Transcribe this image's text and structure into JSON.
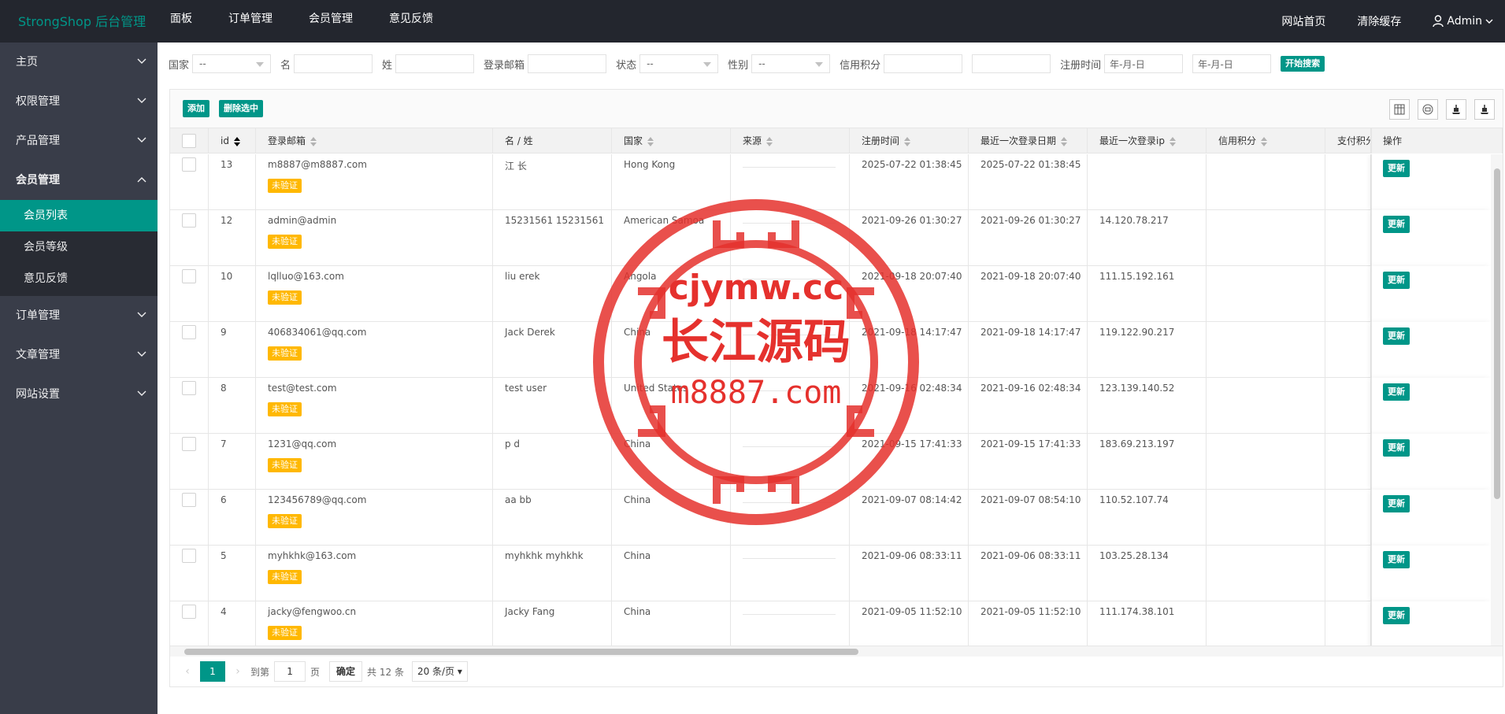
{
  "app": {
    "logo": "StrongShop 后台管理",
    "top_nav": [
      "面板",
      "订单管理",
      "会员管理",
      "意见反馈"
    ],
    "top_right": {
      "home": "网站首页",
      "clear_cache": "清除缓存",
      "user": "Admin"
    }
  },
  "sidebar": {
    "items": [
      {
        "label": "主页"
      },
      {
        "label": "权限管理"
      },
      {
        "label": "产品管理"
      },
      {
        "label": "会员管理"
      },
      {
        "label": "订单管理"
      },
      {
        "label": "文章管理"
      },
      {
        "label": "网站设置"
      }
    ],
    "submenu": [
      "会员列表",
      "会员等级",
      "意见反馈"
    ]
  },
  "filters": {
    "country_label": "国家",
    "country_value": "--",
    "first_name_label": "名",
    "last_name_label": "姓",
    "email_label": "登录邮箱",
    "status_label": "状态",
    "status_value": "--",
    "gender_label": "性别",
    "gender_value": "--",
    "credit_label": "信用积分",
    "reg_time_label": "注册时间",
    "date_placeholder_from": "年-月-日",
    "date_placeholder_to": "年-月-日",
    "search_button": "开始搜索"
  },
  "toolbar": {
    "add": "添加",
    "delete_selected": "删除选中"
  },
  "table": {
    "headers": {
      "id": "id",
      "email": "登录邮箱",
      "name": "名 / 姓",
      "country": "国家",
      "source": "来源",
      "reg_time": "注册时间",
      "last_login_date": "最近一次登录日期",
      "last_login_ip": "最近一次登录ip",
      "credit": "信用积分",
      "pay": "支付积分",
      "op": "操作"
    },
    "unverified_label": "未验证",
    "update_label": "更新",
    "rows": [
      {
        "id": "13",
        "email": "m8887@m8887.com",
        "name": "江 长",
        "country": "Hong Kong",
        "reg": "2025-07-22 01:38:45",
        "last": "2025-07-22 01:38:45",
        "ip": ""
      },
      {
        "id": "12",
        "email": "admin@admin",
        "name": "15231561 15231561",
        "country": "American Samoa",
        "reg": "2021-09-26 01:30:27",
        "last": "2021-09-26 01:30:27",
        "ip": "14.120.78.217"
      },
      {
        "id": "10",
        "email": "lqlluo@163.com",
        "name": "liu erek",
        "country": "Angola",
        "reg": "2021-09-18 20:07:40",
        "last": "2021-09-18 20:07:40",
        "ip": "111.15.192.161"
      },
      {
        "id": "9",
        "email": "406834061@qq.com",
        "name": "Jack Derek",
        "country": "China",
        "reg": "2021-09-18 14:17:47",
        "last": "2021-09-18 14:17:47",
        "ip": "119.122.90.217"
      },
      {
        "id": "8",
        "email": "test@test.com",
        "name": "test user",
        "country": "United States",
        "reg": "2021-09-16 02:48:34",
        "last": "2021-09-16 02:48:34",
        "ip": "123.139.140.52"
      },
      {
        "id": "7",
        "email": "1231@qq.com",
        "name": "p d",
        "country": "China",
        "reg": "2021-09-15 17:41:33",
        "last": "2021-09-15 17:41:33",
        "ip": "183.69.213.197"
      },
      {
        "id": "6",
        "email": "123456789@qq.com",
        "name": "aa bb",
        "country": "China",
        "reg": "2021-09-07 08:14:42",
        "last": "2021-09-07 08:54:10",
        "ip": "110.52.107.74"
      },
      {
        "id": "5",
        "email": "myhkhk@163.com",
        "name": "myhkhk myhkhk",
        "country": "China",
        "reg": "2021-09-06 08:33:11",
        "last": "2021-09-06 08:33:11",
        "ip": "103.25.28.134"
      },
      {
        "id": "4",
        "email": "jacky@fengwoo.cn",
        "name": "Jacky Fang",
        "country": "China",
        "reg": "2021-09-05 11:52:10",
        "last": "2021-09-05 11:52:10",
        "ip": "111.174.38.101"
      }
    ]
  },
  "pager": {
    "current": "1",
    "goto_label": "到第",
    "goto_value": "1",
    "page_label": "页",
    "confirm": "确定",
    "total": "共 12 条",
    "per_page": "20 条/页"
  },
  "watermark": {
    "line1": "cjymw.cc",
    "line2": "长江源码",
    "line3": "m8887.com"
  },
  "colors": {
    "accent": "#009688",
    "topbar": "#23262e",
    "sidebar": "#393d49",
    "badge": "#ffb800",
    "watermark": "#e5312d"
  }
}
